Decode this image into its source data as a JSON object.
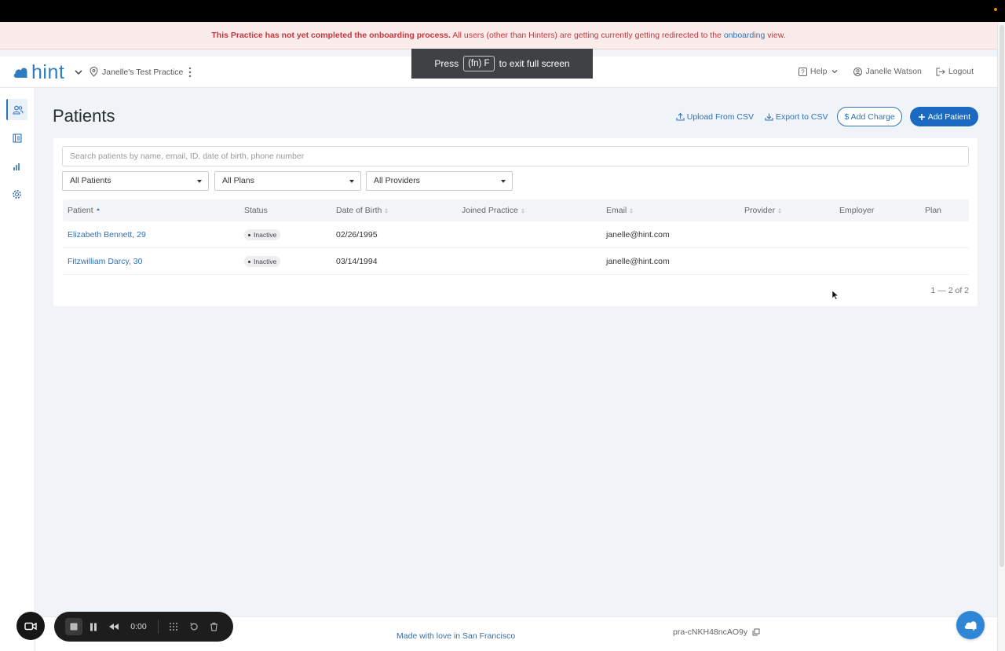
{
  "colors": {
    "brand": "#2e7dbf",
    "primary_button": "#1a6ac2",
    "link": "#2f72b6",
    "alert_text": "#c0363b",
    "alert_bg": "#fbecec"
  },
  "alert": {
    "bold": "This Practice has not yet completed the onboarding process.",
    "text": "All users (other than Hinters) are getting currently getting redirected to the",
    "link": "onboarding",
    "suffix": "view."
  },
  "fullscreen_toast": {
    "press": "Press",
    "key": "(fn) F",
    "rest": "to exit full screen"
  },
  "header": {
    "logo_text": "hint",
    "practice_name": "Janelle's Test Practice",
    "help": "Help",
    "user": "Janelle Watson",
    "logout": "Logout"
  },
  "sidebar": {
    "items": [
      {
        "icon": "patients-icon",
        "active": true
      },
      {
        "icon": "ledger-icon",
        "active": false
      },
      {
        "icon": "bar-chart-icon",
        "active": false
      },
      {
        "icon": "gear-icon",
        "active": false
      }
    ]
  },
  "page": {
    "title": "Patients",
    "upload": "Upload From CSV",
    "export": "Export to CSV",
    "add_charge": "$ Add Charge",
    "add_patient": "Add Patient"
  },
  "search": {
    "placeholder": "Search patients by name, email, ID, date of birth, phone number"
  },
  "filters": {
    "patients": "All Patients",
    "plans": "All Plans",
    "providers": "All Providers"
  },
  "table": {
    "columns": [
      "Patient",
      "Status",
      "Date of Birth",
      "Joined Practice",
      "Email",
      "Provider",
      "Employer",
      "Plan"
    ],
    "rows": [
      {
        "patient": "Elizabeth Bennett, 29",
        "status": "Inactive",
        "dob": "02/26/1995",
        "joined": "",
        "email": "janelle@hint.com",
        "provider": "",
        "employer": "",
        "plan": ""
      },
      {
        "patient": "Fitzwilliam Darcy, 30",
        "status": "Inactive",
        "dob": "03/14/1994",
        "joined": "",
        "email": "janelle@hint.com",
        "provider": "",
        "employer": "",
        "plan": ""
      }
    ],
    "pager": "1 — 2 of 2"
  },
  "footer": {
    "made": "Made with love in San Francisco",
    "code": "pra-cNKH48ncAO9y"
  },
  "recorder": {
    "time": "0:00"
  }
}
